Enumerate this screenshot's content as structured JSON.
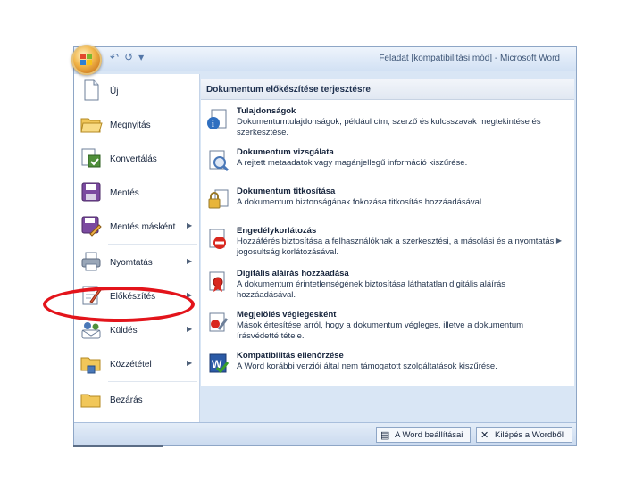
{
  "window": {
    "title": "Feladat [kompatibilitási mód] - Microsoft Word"
  },
  "qat": {
    "undo": "↶",
    "redo": "↺",
    "more": "▾"
  },
  "left_menu": [
    {
      "label": "Új",
      "icon": "new-document-icon"
    },
    {
      "label": "Megnyitás",
      "icon": "open-folder-icon"
    },
    {
      "label": "Konvertálás",
      "icon": "convert-icon"
    },
    {
      "label": "Mentés",
      "icon": "save-icon"
    },
    {
      "label": "Mentés másként",
      "icon": "save-as-icon",
      "submenu": true
    },
    {
      "label": "Nyomtatás",
      "icon": "print-icon",
      "submenu": true
    },
    {
      "label": "Előkészítés",
      "icon": "prepare-icon",
      "submenu": true
    },
    {
      "label": "Küldés",
      "icon": "send-icon",
      "submenu": true
    },
    {
      "label": "Közzététel",
      "icon": "publish-icon",
      "submenu": true
    },
    {
      "label": "Bezárás",
      "icon": "close-folder-icon"
    }
  ],
  "right_panel": {
    "header": "Dokumentum előkészítése terjesztésre",
    "items": [
      {
        "title": "Tulajdonságok",
        "desc": "Dokumentumtulajdonságok, például cím, szerző és kulcsszavak megtekintése és szerkesztése.",
        "icon": "properties-icon"
      },
      {
        "title": "Dokumentum vizsgálata",
        "desc": "A rejtett metaadatok vagy magánjellegű információ kiszűrése.",
        "icon": "inspect-document-icon"
      },
      {
        "title": "Dokumentum titkosítása",
        "desc": "A dokumentum biztonságának fokozása titkosítás hozzáadásával.",
        "icon": "encrypt-lock-icon"
      },
      {
        "title": "Engedélykorlátozás",
        "desc": "Hozzáférés biztosítása a felhasználóknak a szerkesztési, a másolási és a nyomtatási jogosultság korlátozásával.",
        "icon": "restrict-permission-icon",
        "submenu": true
      },
      {
        "title": "Digitális aláírás hozzáadása",
        "desc": "A dokumentum érintetlenségének biztosítása láthatatlan digitális aláírás hozzáadásával.",
        "icon": "digital-signature-icon"
      },
      {
        "title": "Megjelölés véglegesként",
        "desc": "Mások értesítése arról, hogy a dokumentum végleges, illetve a dokumentum írásvédetté tétele.",
        "icon": "mark-final-icon"
      },
      {
        "title": "Kompatibilitás ellenőrzése",
        "desc": "A Word korábbi verziói által nem támogatott szolgáltatások kiszűrése.",
        "icon": "compatibility-check-icon"
      }
    ]
  },
  "bottom": {
    "options_label": "A Word beállításai",
    "exit_label": "Kilépés a Wordből"
  },
  "colors": {
    "highlight_ring": "#e3141b",
    "window_bg": "#d9e6f5"
  }
}
